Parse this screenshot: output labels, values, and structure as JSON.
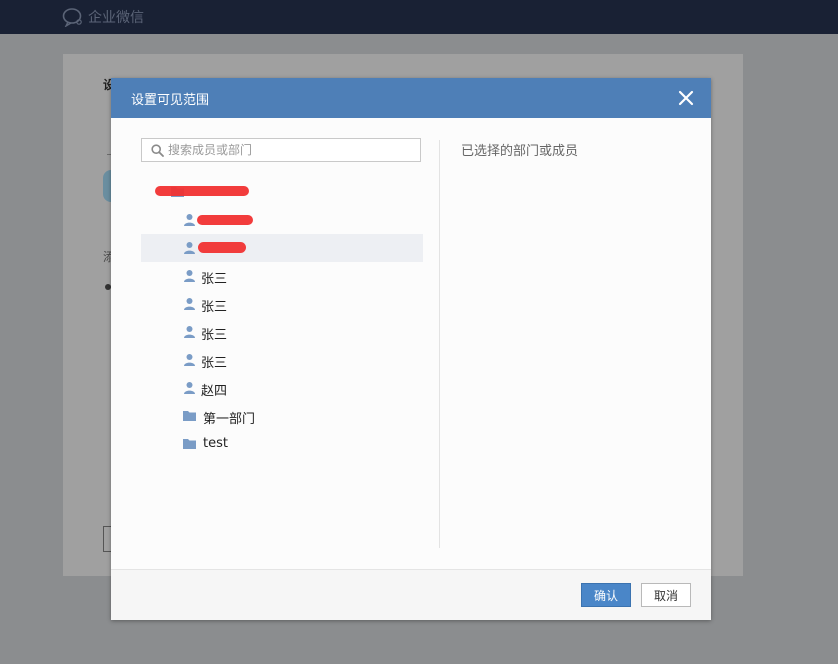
{
  "app": {
    "name": "企业微信"
  },
  "dialog": {
    "title": "设置可见范围",
    "search_placeholder": "搜索成员或部门",
    "selected_title": "已选择的部门或成员",
    "confirm_label": "确认",
    "cancel_label": "取消"
  },
  "tree": {
    "items": [
      {
        "type": "folder",
        "label": "",
        "redacted": true
      },
      {
        "type": "member",
        "label": "",
        "redacted": true
      },
      {
        "type": "member",
        "label": "",
        "redacted": true,
        "selected": true
      },
      {
        "type": "member",
        "label": "张三"
      },
      {
        "type": "member",
        "label": "张三"
      },
      {
        "type": "member",
        "label": "张三"
      },
      {
        "type": "member",
        "label": "张三"
      },
      {
        "type": "member",
        "label": "赵四"
      },
      {
        "type": "folder",
        "label": "第一部门"
      },
      {
        "type": "folder",
        "label": "test"
      }
    ]
  },
  "background": {
    "heading_fragment": "设",
    "text_fragment": "添"
  },
  "colors": {
    "header": "#4e7fb7",
    "topbar": "#192134",
    "confirm": "#4a86c8",
    "icon": "#7a9cc6",
    "redaction": "#f13232"
  }
}
